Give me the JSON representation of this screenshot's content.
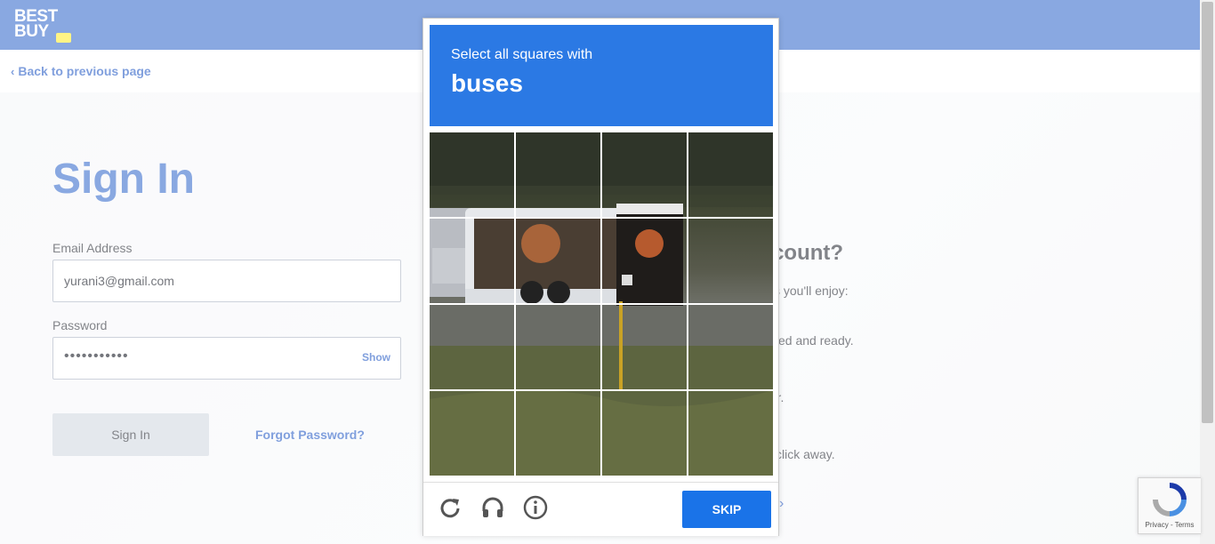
{
  "header": {
    "logo_line1": "BEST",
    "logo_line2": "BUY"
  },
  "nav": {
    "back_label": "Back to previous page"
  },
  "signin": {
    "title": "Sign In",
    "email_label": "Email Address",
    "email_value": "yurani3@gmail.com",
    "password_label": "Password",
    "password_value": "•••••••••••",
    "show_label": "Show",
    "signin_button": "Sign In",
    "forgot_label": "Forgot Password?"
  },
  "right_panel": {
    "title_partial": "ave an account?",
    "subtitle_partial": "s you'll enjoy:",
    "benefit1_partial": "ved and ready.",
    "benefit2_partial": "der.",
    "benefit3_partial": "click away."
  },
  "captcha": {
    "instruction": "Select all squares with",
    "target": "buses",
    "skip_label": "SKIP",
    "footer_icons": [
      "reload-icon",
      "audio-icon",
      "info-icon"
    ],
    "grid_size": [
      4,
      4
    ]
  },
  "recaptcha_badge": {
    "terms": "Privacy - Terms"
  },
  "colors": {
    "brand_blue": "#7599dc",
    "link_blue": "#6a8fd8",
    "captcha_blue": "#2b79e4",
    "skip_blue": "#1a73e8",
    "logo_tag_yellow": "#fff371"
  }
}
